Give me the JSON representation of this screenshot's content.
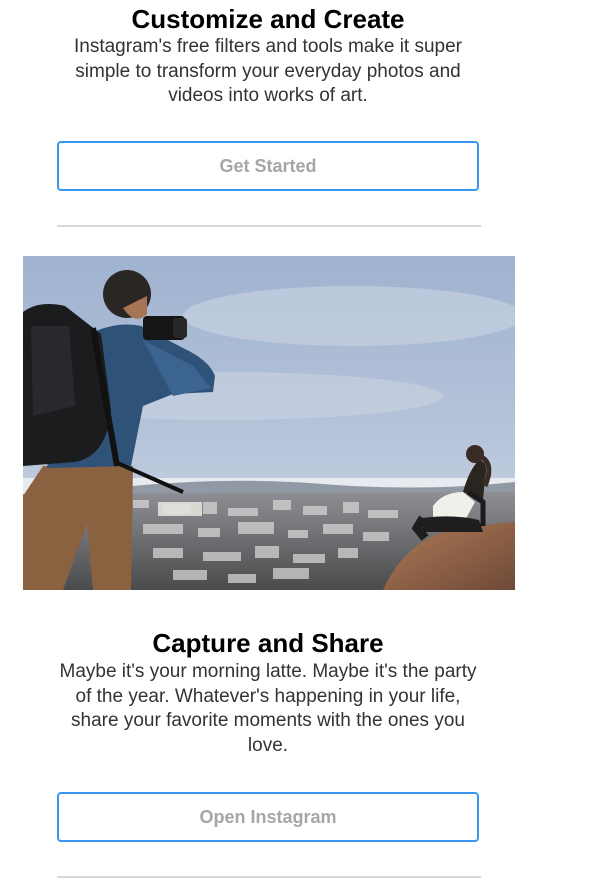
{
  "sections": [
    {
      "title": "Customize and Create",
      "body": "Instagram's free filters and tools make it super simple to transform your everyday photos and videos into works of art.",
      "button_label": "Get Started"
    },
    {
      "title": "Capture and Share",
      "body": "Maybe it's your morning latte. Maybe it's the party of the year. Whatever's happening in your life, share your favorite moments with the ones you love.",
      "button_label": "Open Instagram"
    }
  ],
  "photo": {
    "subject": "photographer-and-woman-overlooking-city-photo"
  },
  "colors": {
    "button_border": "#3897f0",
    "button_text": "#a6a6a6",
    "divider": "#d9d9d9",
    "title": "#000000",
    "body_text": "#333333"
  }
}
